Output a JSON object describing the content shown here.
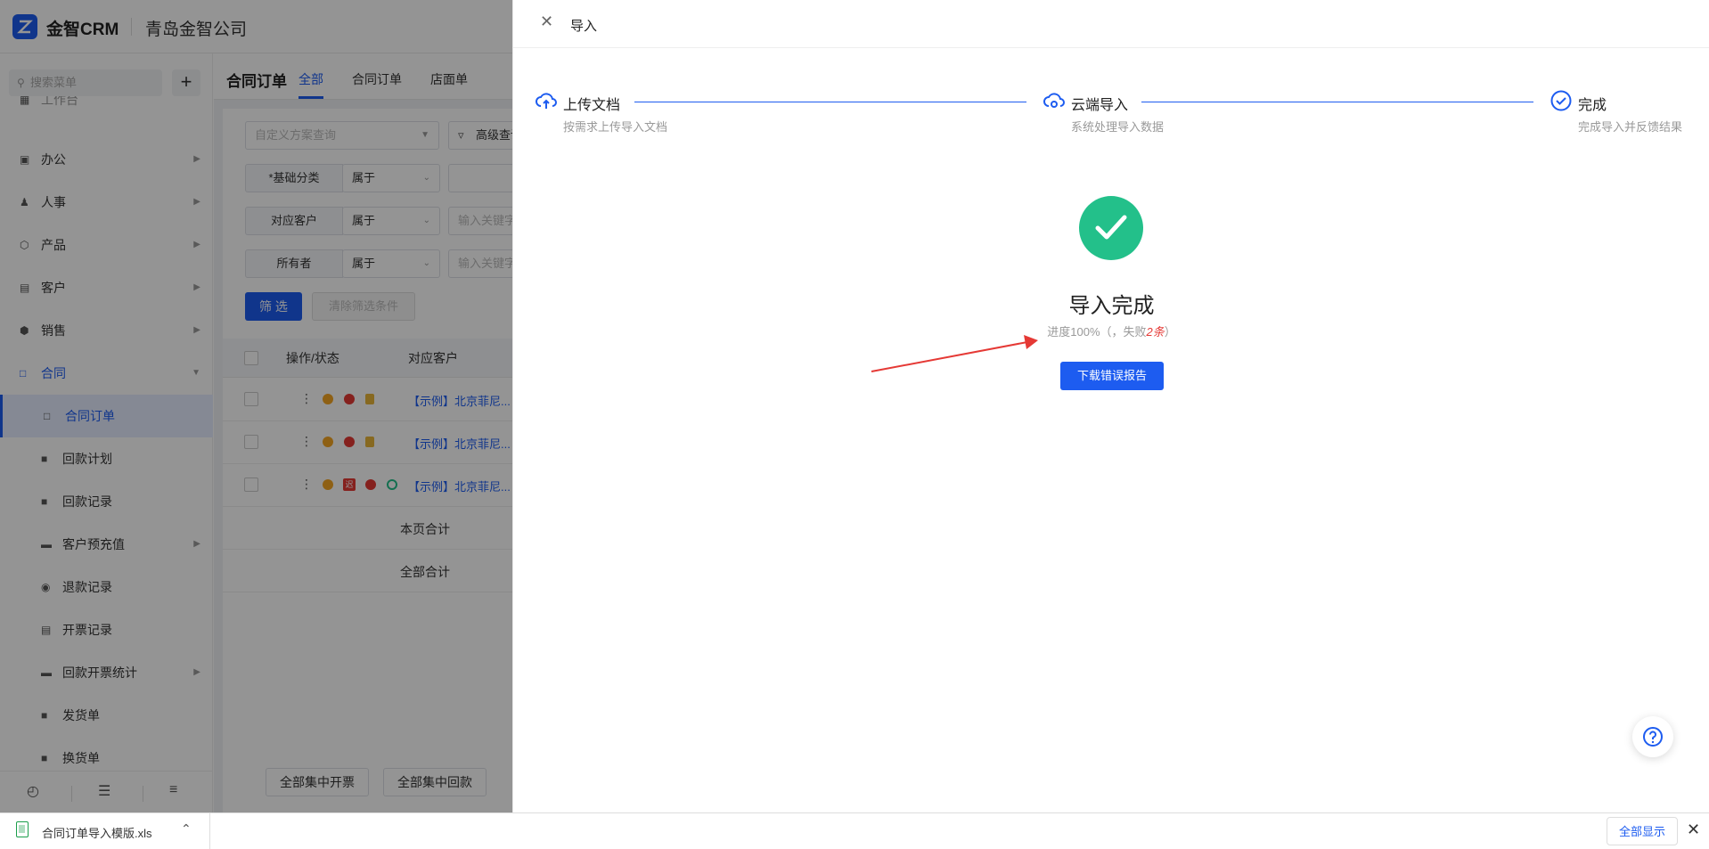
{
  "topbar": {
    "brand": "金智CRM",
    "company": "青岛金智公司"
  },
  "sidebar": {
    "search_placeholder": "搜索菜单",
    "add_label": "+",
    "cut_item": "工作台",
    "items": [
      {
        "label": "办公"
      },
      {
        "label": "人事"
      },
      {
        "label": "产品"
      },
      {
        "label": "客户"
      },
      {
        "label": "销售"
      },
      {
        "label": "合同"
      }
    ],
    "sub_items": [
      {
        "label": "合同订单"
      },
      {
        "label": "回款计划"
      },
      {
        "label": "回款记录"
      },
      {
        "label": "客户预充值"
      },
      {
        "label": "退款记录"
      },
      {
        "label": "开票记录"
      },
      {
        "label": "回款开票统计"
      },
      {
        "label": "发货单"
      },
      {
        "label": "换货单"
      }
    ]
  },
  "main": {
    "page_title": "合同订单",
    "tabs": [
      {
        "label": "全部"
      },
      {
        "label": "合同订单"
      },
      {
        "label": "店面单"
      }
    ],
    "filter": {
      "scheme_placeholder": "自定义方案查询",
      "advanced": "高级查询",
      "rows": [
        {
          "label": "*基础分类",
          "op": "属于",
          "placeholder": ""
        },
        {
          "label": "对应客户",
          "op": "属于",
          "placeholder": "输入关键字"
        },
        {
          "label": "所有者",
          "op": "属于",
          "placeholder": "输入关键字"
        }
      ],
      "filter_btn": "筛 选",
      "clear_btn": "清除筛选条件"
    },
    "table": {
      "headers": [
        "操作/状态",
        "对应客户"
      ],
      "rows": [
        {
          "customer": "【示例】北京菲尼..."
        },
        {
          "customer": "【示例】北京菲尼..."
        },
        {
          "customer": "【示例】北京菲尼..."
        }
      ],
      "badge_late": "迟",
      "page_total": "本页合计",
      "all_total": "全部合计"
    },
    "bottom_buttons": [
      "全部集中开票",
      "全部集中回款"
    ]
  },
  "drawer": {
    "title": "导入",
    "steps": [
      {
        "title": "上传文档",
        "desc": "按需求上传导入文档"
      },
      {
        "title": "云端导入",
        "desc": "系统处理导入数据"
      },
      {
        "title": "完成",
        "desc": "完成导入并反馈结果"
      }
    ],
    "done_title": "导入完成",
    "progress_prefix": "进度100%（，失败",
    "progress_fail": "2条",
    "progress_suffix": "）",
    "download_btn": "下载错误报告"
  },
  "download_bar": {
    "file_name": "合同订单导入模版.xls",
    "show_all": "全部显示"
  },
  "colors": {
    "primary": "#1d5cf0",
    "success": "#23c08a",
    "danger": "#e53935"
  }
}
